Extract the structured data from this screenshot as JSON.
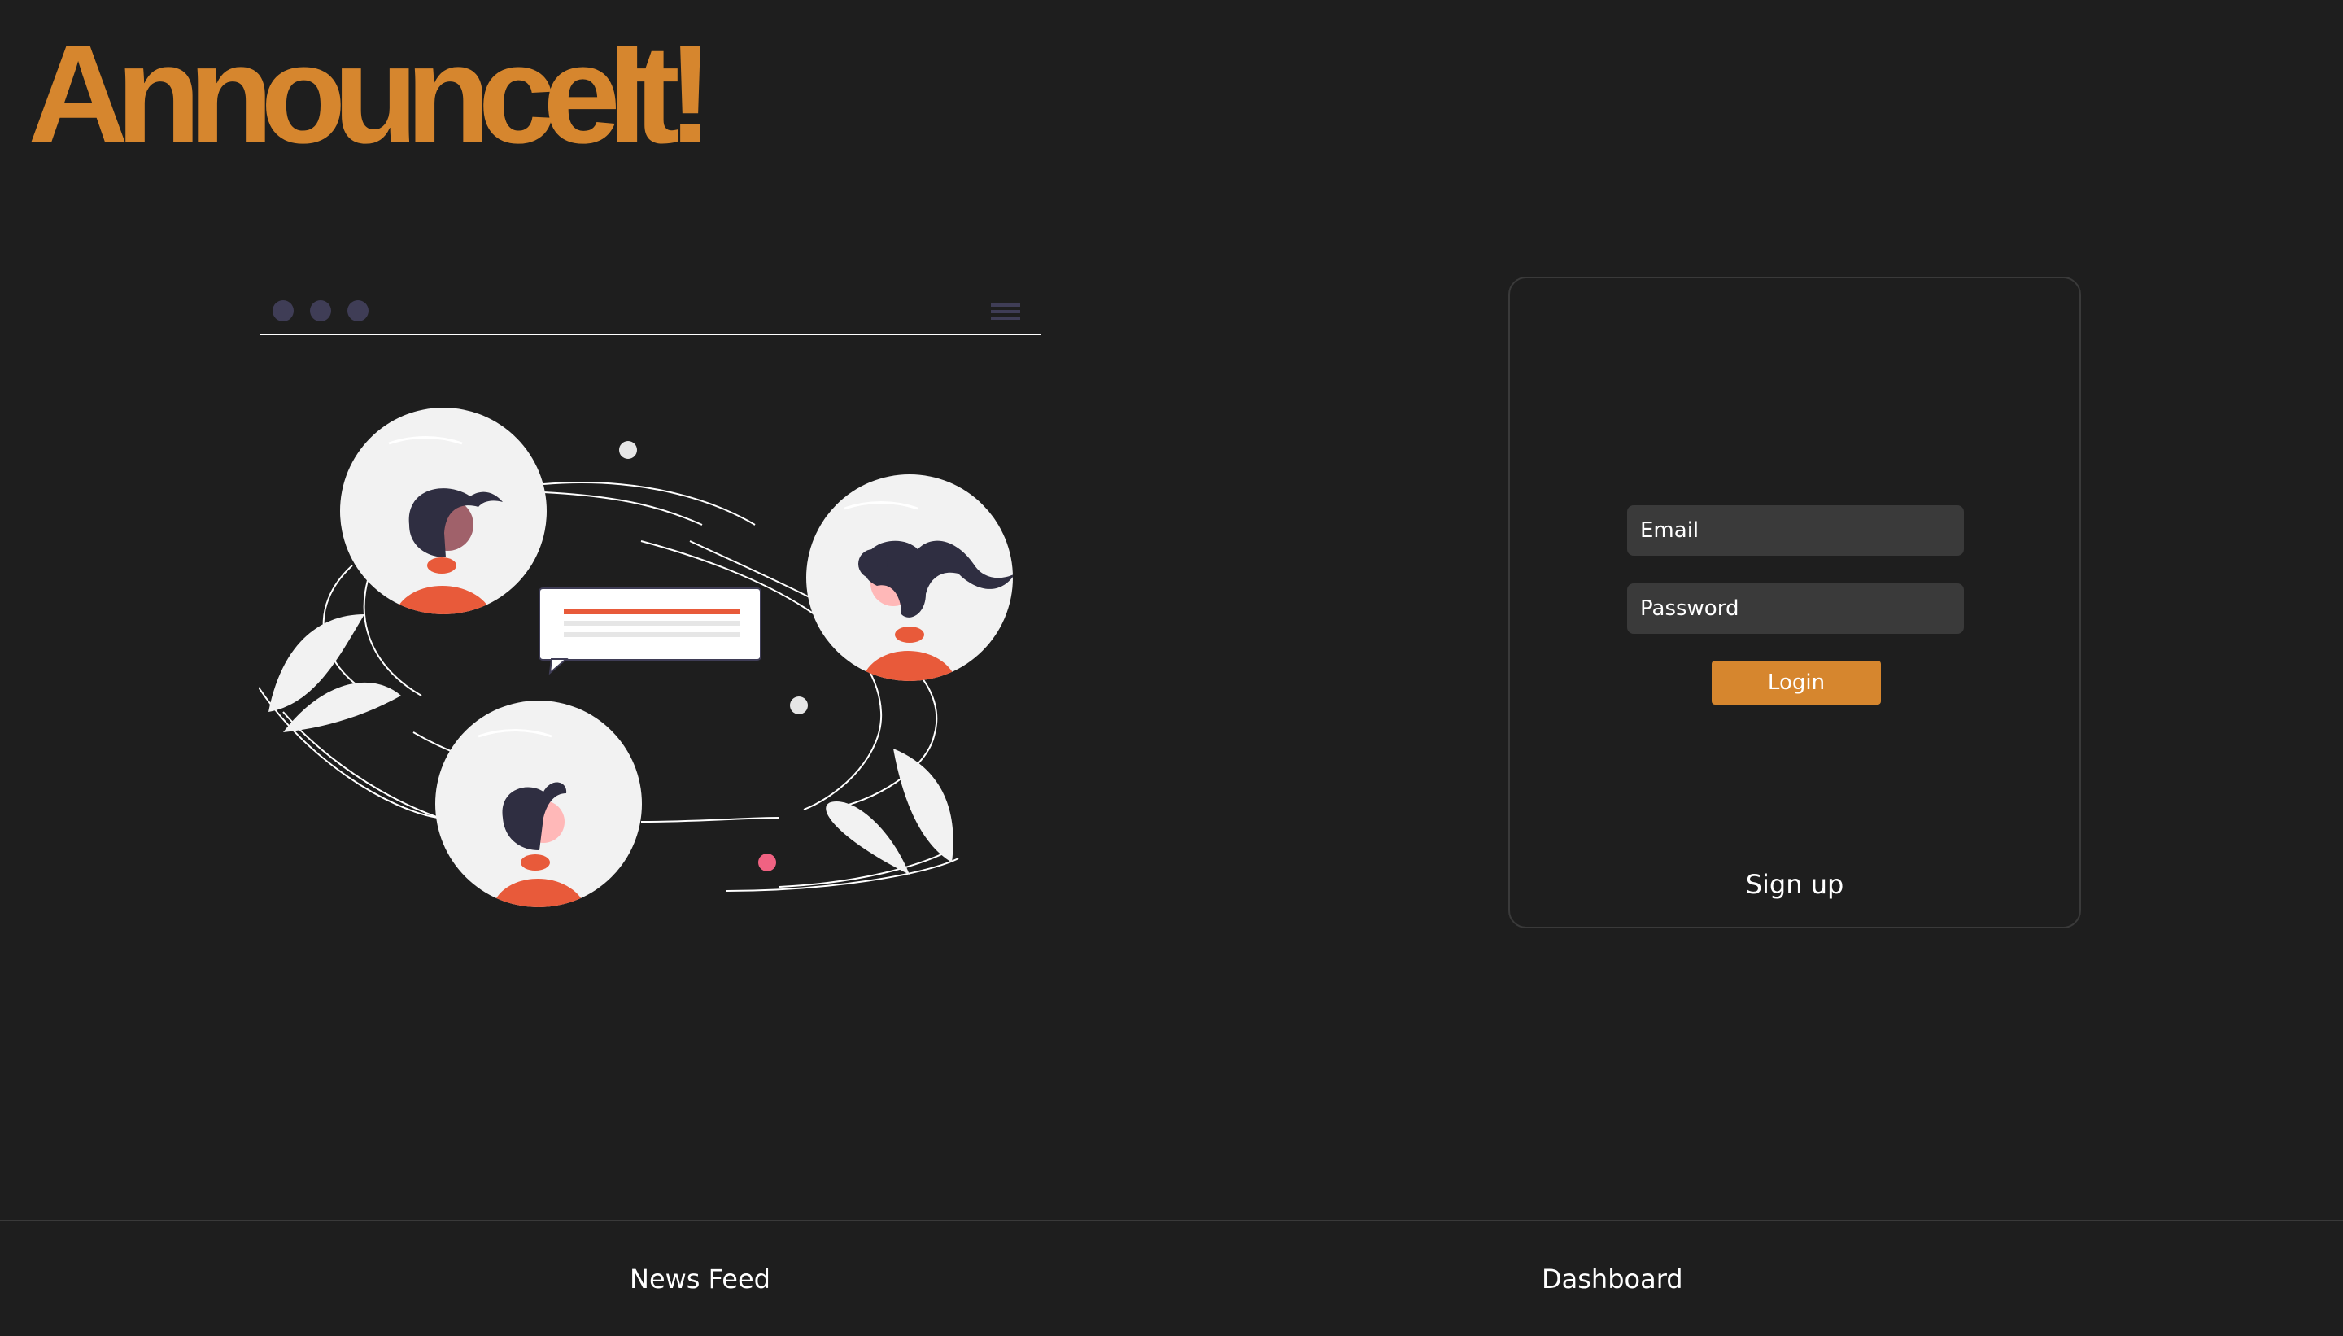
{
  "app": {
    "logo_text": "AnnounceIt!",
    "accent_color": "#d6862e",
    "background_color": "#1e1e1e"
  },
  "illustration": {
    "description_icon": "group-chat-illustration"
  },
  "login": {
    "email_placeholder": "Email",
    "password_placeholder": "Password",
    "login_label": "Login",
    "signup_label": "Sign up"
  },
  "footer": {
    "items": [
      {
        "label": "News Feed"
      },
      {
        "label": "Dashboard"
      }
    ]
  }
}
